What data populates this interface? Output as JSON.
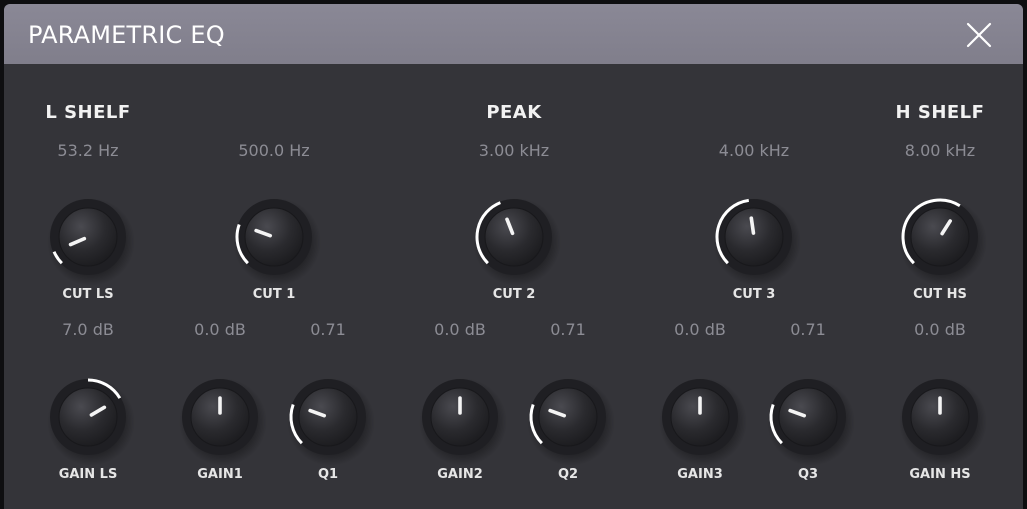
{
  "window": {
    "title": "PARAMETRIC EQ",
    "close_icon": "close-icon"
  },
  "sections": {
    "low_shelf": "L SHELF",
    "peak": "PEAK",
    "high_shelf": "H SHELF"
  },
  "colors": {
    "panel": "#343439",
    "titlebar": "#85838f",
    "arc": "#ffffff",
    "value_text": "#8c8c94"
  },
  "knobs": [
    {
      "id": "cut-ls",
      "label": "CUT LS",
      "value": "53.2 Hz",
      "level": 0.08
    },
    {
      "id": "cut-1",
      "label": "CUT 1",
      "value": "500.0 Hz",
      "level": 0.24
    },
    {
      "id": "cut-2",
      "label": "CUT 2",
      "value": "3.00 kHz",
      "level": 0.42
    },
    {
      "id": "cut-3",
      "label": "CUT 3",
      "value": "4.00 kHz",
      "level": 0.47
    },
    {
      "id": "cut-hs",
      "label": "CUT HS",
      "value": "8.00 kHz",
      "level": 0.62
    },
    {
      "id": "gain-ls",
      "label": "GAIN LS",
      "value": "7.0 dB",
      "level": 0.72,
      "bipolar": true
    },
    {
      "id": "gain-1",
      "label": "GAIN1",
      "value": "0.0 dB",
      "level": 0.5,
      "bipolar": true
    },
    {
      "id": "q-1",
      "label": "Q1",
      "value": "0.71",
      "level": 0.24
    },
    {
      "id": "gain-2",
      "label": "GAIN2",
      "value": "0.0 dB",
      "level": 0.5,
      "bipolar": true
    },
    {
      "id": "q-2",
      "label": "Q2",
      "value": "0.71",
      "level": 0.24
    },
    {
      "id": "gain-3",
      "label": "GAIN3",
      "value": "0.0 dB",
      "level": 0.5,
      "bipolar": true
    },
    {
      "id": "q-3",
      "label": "Q3",
      "value": "0.71",
      "level": 0.24
    },
    {
      "id": "gain-hs",
      "label": "GAIN HS",
      "value": "0.0 dB",
      "level": 0.5,
      "bipolar": true
    }
  ]
}
